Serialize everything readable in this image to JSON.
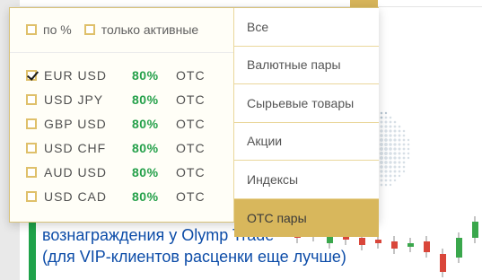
{
  "dropdown": {
    "filters": [
      {
        "label": "по %",
        "checked": false
      },
      {
        "label": "только активные",
        "checked": false
      }
    ],
    "assets": [
      {
        "name": "EUR USD",
        "percent": "80%",
        "tag": "OTC",
        "checked": true
      },
      {
        "name": "USD JPY",
        "percent": "80%",
        "tag": "OTC",
        "checked": false
      },
      {
        "name": "GBP USD",
        "percent": "80%",
        "tag": "OTC",
        "checked": false
      },
      {
        "name": "USD CHF",
        "percent": "80%",
        "tag": "OTC",
        "checked": false
      },
      {
        "name": "AUD USD",
        "percent": "80%",
        "tag": "OTC",
        "checked": false
      },
      {
        "name": "USD CAD",
        "percent": "80%",
        "tag": "OTC",
        "checked": false
      }
    ],
    "categories": [
      {
        "label": "Все",
        "active": false
      },
      {
        "label": "Валютные пары",
        "active": false
      },
      {
        "label": "Сырьевые товары",
        "active": false
      },
      {
        "label": "Акции",
        "active": false
      },
      {
        "label": "Индексы",
        "active": false
      },
      {
        "label": "ОТС пары",
        "active": true
      }
    ]
  },
  "banner": {
    "line1": "вознаграждения у Olymp Trade",
    "line2": "(для VIP-клиентов расценки еще лучше)"
  },
  "colors": {
    "accent_gold": "#d8b75c",
    "percent_green": "#24a04a",
    "banner_blue": "#0c4ca8",
    "green_bar": "#1fa24a"
  }
}
